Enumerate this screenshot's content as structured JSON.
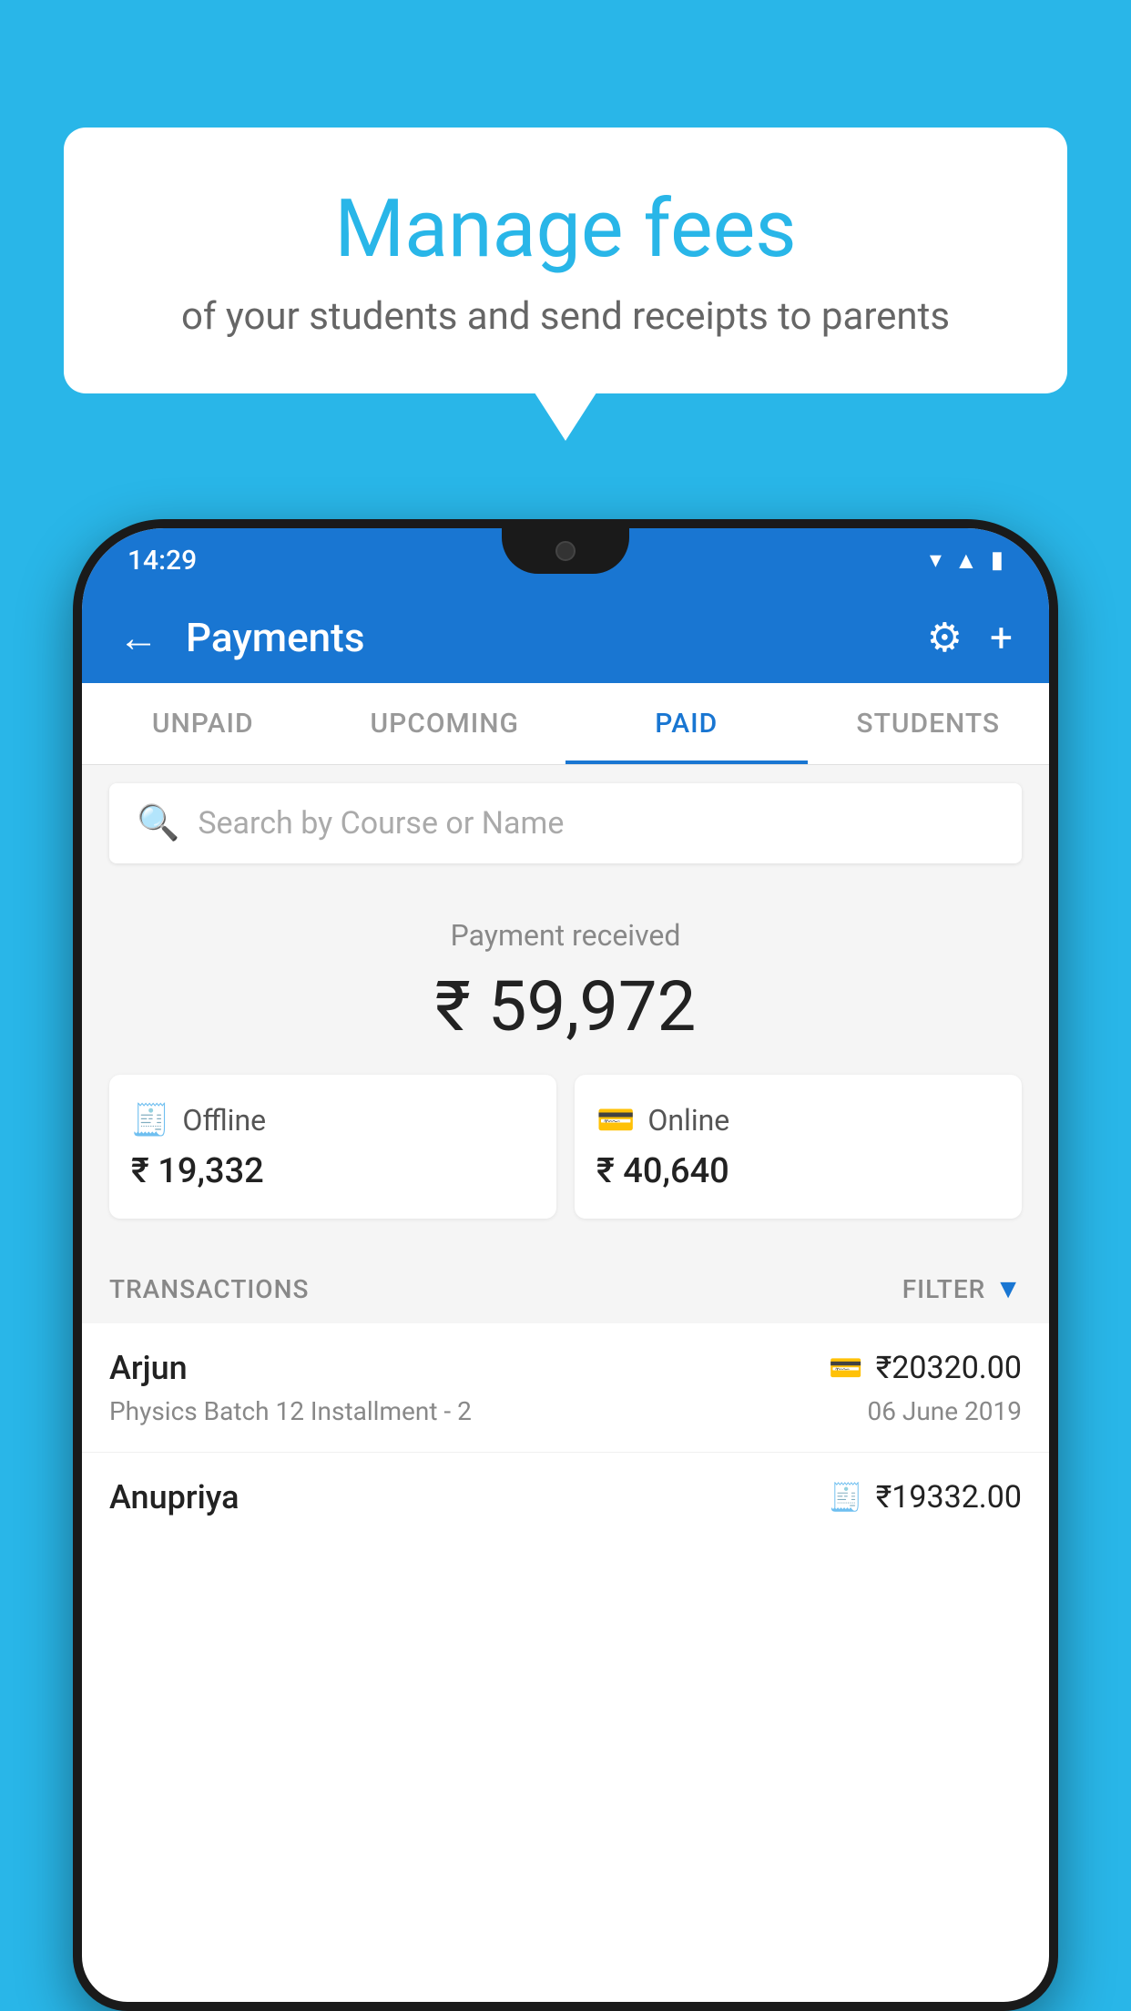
{
  "background_color": "#29b6e8",
  "bubble": {
    "title": "Manage fees",
    "subtitle": "of your students and send receipts to parents"
  },
  "status_bar": {
    "time": "14:29"
  },
  "app_bar": {
    "title": "Payments",
    "back_label": "←",
    "gear_label": "⚙",
    "plus_label": "+"
  },
  "tabs": [
    {
      "label": "UNPAID",
      "active": false
    },
    {
      "label": "UPCOMING",
      "active": false
    },
    {
      "label": "PAID",
      "active": true
    },
    {
      "label": "STUDENTS",
      "active": false
    }
  ],
  "search": {
    "placeholder": "Search by Course or Name"
  },
  "payment_summary": {
    "received_label": "Payment received",
    "total_amount": "₹ 59,972",
    "offline": {
      "label": "Offline",
      "amount": "₹ 19,332"
    },
    "online": {
      "label": "Online",
      "amount": "₹ 40,640"
    }
  },
  "transactions_section": {
    "label": "TRANSACTIONS",
    "filter_label": "FILTER"
  },
  "transactions": [
    {
      "name": "Arjun",
      "amount": "₹20320.00",
      "course": "Physics Batch 12 Installment - 2",
      "date": "06 June 2019",
      "payment_type": "card"
    },
    {
      "name": "Anupriya",
      "amount": "₹19332.00",
      "course": "",
      "date": "",
      "payment_type": "cash"
    }
  ]
}
